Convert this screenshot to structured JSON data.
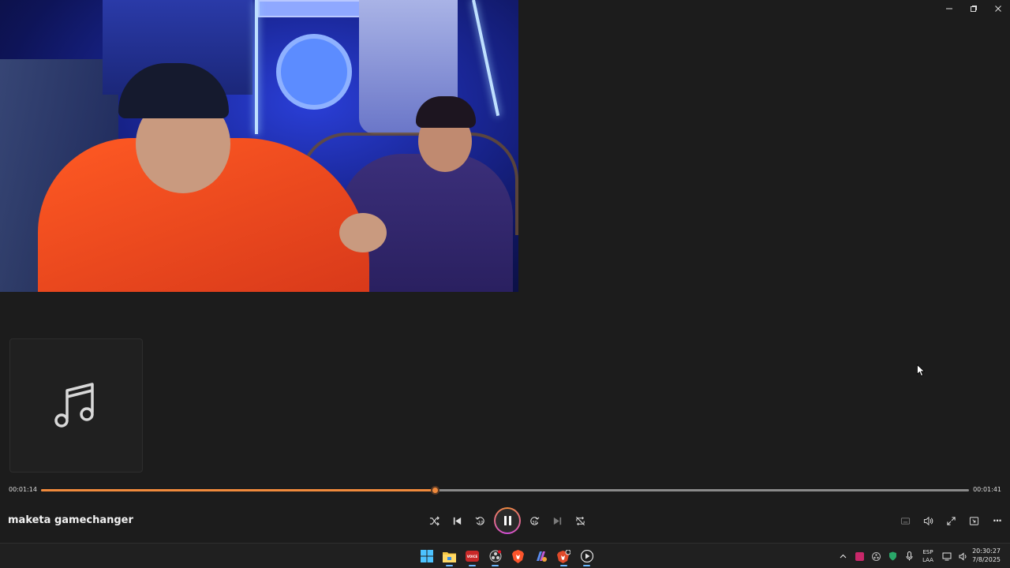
{
  "player": {
    "track_title": "maketa gamechanger",
    "time_elapsed": "00:01:14",
    "time_total": "00:01:41",
    "progress": 0.424
  },
  "colors": {
    "accent": "#f08a3c",
    "background": "#1c1c1c",
    "taskbar": "#202020"
  },
  "controls": {
    "center": [
      "shuffle-icon",
      "previous-icon",
      "skip-back-10-icon",
      "pause-icon",
      "skip-forward-30-icon",
      "next-icon",
      "repeat-off-icon"
    ],
    "right": [
      "captions-icon",
      "volume-icon",
      "fullscreen-icon",
      "mini-player-icon",
      "more-icon"
    ],
    "skip_back_label": "10",
    "skip_forward_label": "30",
    "more_label": "···"
  },
  "taskbar": {
    "apps": [
      "windows-start-icon",
      "file-explorer-icon",
      "voicemeeter-icon",
      "obs-icon",
      "brave-icon",
      "copilot-icon",
      "brave-beta-icon",
      "media-player-icon"
    ],
    "voicemeeter_label": "VOICE",
    "tray": {
      "lang_line1": "ESP",
      "lang_line2": "LAA",
      "time": "20:30:27",
      "date": "7/8/2025"
    }
  }
}
